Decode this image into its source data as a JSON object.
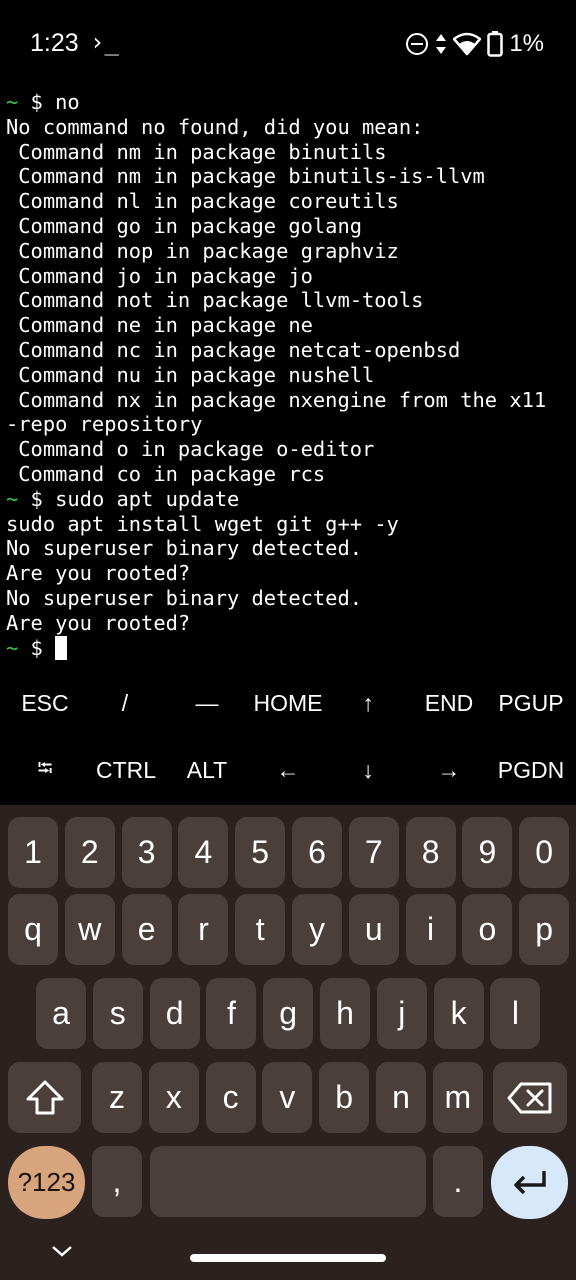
{
  "status": {
    "time": "1:23",
    "app_indicator": "›_",
    "battery": "1%",
    "icons": [
      "do-not-disturb-icon",
      "data-transfer-icon",
      "wifi-icon",
      "battery-icon"
    ]
  },
  "terminal": {
    "lines": [
      {
        "prompt": "~",
        "text": " $ no"
      },
      {
        "prompt": "",
        "text": "No command no found, did you mean:"
      },
      {
        "prompt": "",
        "text": " Command nm in package binutils"
      },
      {
        "prompt": "",
        "text": " Command nm in package binutils-is-llvm"
      },
      {
        "prompt": "",
        "text": " Command nl in package coreutils"
      },
      {
        "prompt": "",
        "text": " Command go in package golang"
      },
      {
        "prompt": "",
        "text": " Command nop in package graphviz"
      },
      {
        "prompt": "",
        "text": " Command jo in package jo"
      },
      {
        "prompt": "",
        "text": " Command not in package llvm-tools"
      },
      {
        "prompt": "",
        "text": " Command ne in package ne"
      },
      {
        "prompt": "",
        "text": " Command nc in package netcat-openbsd"
      },
      {
        "prompt": "",
        "text": " Command nu in package nushell"
      },
      {
        "prompt": "",
        "text": " Command nx in package nxengine from the x11"
      },
      {
        "prompt": "",
        "text": "-repo repository"
      },
      {
        "prompt": "",
        "text": " Command o in package o-editor"
      },
      {
        "prompt": "",
        "text": " Command co in package rcs"
      },
      {
        "prompt": "~",
        "text": " $ sudo apt update"
      },
      {
        "prompt": "",
        "text": "sudo apt install wget git g++ -y"
      },
      {
        "prompt": "",
        "text": "No superuser binary detected."
      },
      {
        "prompt": "",
        "text": "Are you rooted?"
      },
      {
        "prompt": "",
        "text": "No superuser binary detected."
      },
      {
        "prompt": "",
        "text": "Are you rooted?"
      },
      {
        "prompt": "~",
        "text": " $ "
      }
    ],
    "prompt_color": "#2ecc40"
  },
  "extra_keys": {
    "row1": [
      "ESC",
      "/",
      "—",
      "HOME",
      "↑",
      "END",
      "PGUP"
    ],
    "row2": [
      "⭾",
      "CTRL",
      "ALT",
      "←",
      "↓",
      "→",
      "PGDN"
    ]
  },
  "keyboard": {
    "row_numbers": [
      "1",
      "2",
      "3",
      "4",
      "5",
      "6",
      "7",
      "8",
      "9",
      "0"
    ],
    "row_top": [
      "q",
      "w",
      "e",
      "r",
      "t",
      "y",
      "u",
      "i",
      "o",
      "p"
    ],
    "row_mid": [
      "a",
      "s",
      "d",
      "f",
      "g",
      "h",
      "j",
      "k",
      "l"
    ],
    "row_bottom": [
      "z",
      "x",
      "c",
      "v",
      "b",
      "n",
      "m"
    ],
    "symbols_key": "?123",
    "comma_key": ",",
    "period_key": ".",
    "colors": {
      "background": "#2b2220",
      "key": "#4b3f3c",
      "symbols": "#d7a47e",
      "enter": "#d7e8fa"
    }
  }
}
